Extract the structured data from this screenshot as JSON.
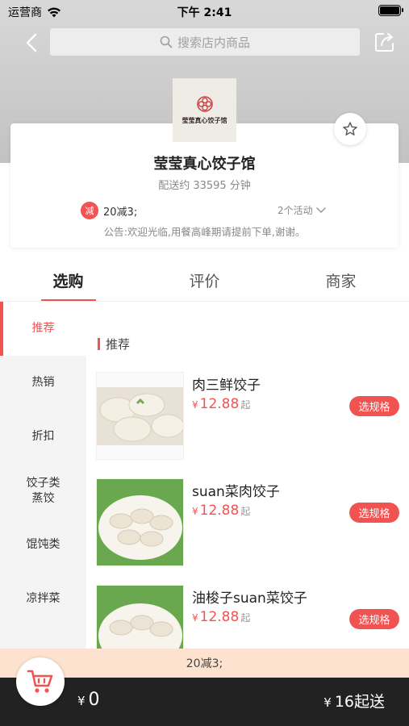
{
  "status_bar": {
    "carrier": "运营商",
    "time": "下午 2:41"
  },
  "header": {
    "search_placeholder": "搜索店内商品"
  },
  "shop": {
    "logo_text": "莹莹真心饺子馆",
    "name": "莹莹真心饺子馆",
    "delivery_time": "配送约 33595 分钟",
    "promo_badge": "减",
    "promo_text": "20减3;",
    "activities": "2个活动",
    "notice": "公告:欢迎光临,用餐高峰期请提前下单,谢谢。"
  },
  "tabs": [
    "选购",
    "评价",
    "商家"
  ],
  "categories": [
    "推荐",
    "热销",
    "折扣",
    "饺子类\n蒸饺",
    "馄饨类",
    "凉拌菜"
  ],
  "section_title": "推荐",
  "products": [
    {
      "name": "肉三鲜饺子",
      "currency": "¥",
      "price": "12.88",
      "suffix": "起",
      "button": "选规格"
    },
    {
      "name": "suan菜肉饺子",
      "currency": "¥",
      "price": "12.88",
      "suffix": "起",
      "button": "选规格"
    },
    {
      "name": "油梭子suan菜饺子",
      "currency": "¥",
      "price": "12.88",
      "suffix": "起",
      "button": "选规格"
    }
  ],
  "bottom": {
    "discount": "20减3;",
    "cart_currency": "¥",
    "cart_total": "0",
    "min_order_currency": "¥",
    "min_order": "16起送"
  },
  "colors": {
    "accent": "#f15353",
    "cart_bar": "#222222",
    "discount_bar": "#fde3cf"
  }
}
